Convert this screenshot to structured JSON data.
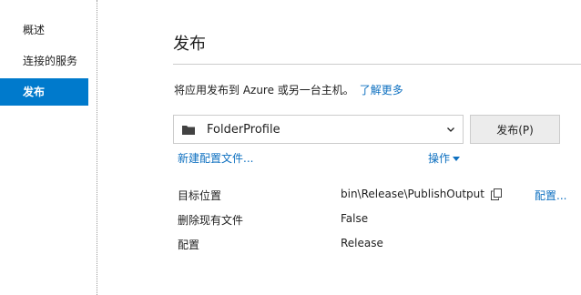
{
  "sidebar": {
    "items": [
      {
        "label": "概述",
        "active": false
      },
      {
        "label": "连接的服务",
        "active": false
      },
      {
        "label": "发布",
        "active": true
      }
    ]
  },
  "main": {
    "title": "发布",
    "description": "将应用发布到 Azure 或另一台主机。",
    "learn_more": "了解更多",
    "profile_select": {
      "value": "FolderProfile",
      "icon": "folder-icon"
    },
    "publish_button": "发布(P)",
    "new_profile_link": "新建配置文件...",
    "actions_link": "操作",
    "details": [
      {
        "label": "目标位置",
        "value": "bin\\Release\\PublishOutput",
        "has_copy": true,
        "link": "配置..."
      },
      {
        "label": "删除现有文件",
        "value": "False"
      },
      {
        "label": "配置",
        "value": "Release"
      }
    ]
  },
  "colors": {
    "accent": "#007acc",
    "link": "#0e70c0"
  }
}
